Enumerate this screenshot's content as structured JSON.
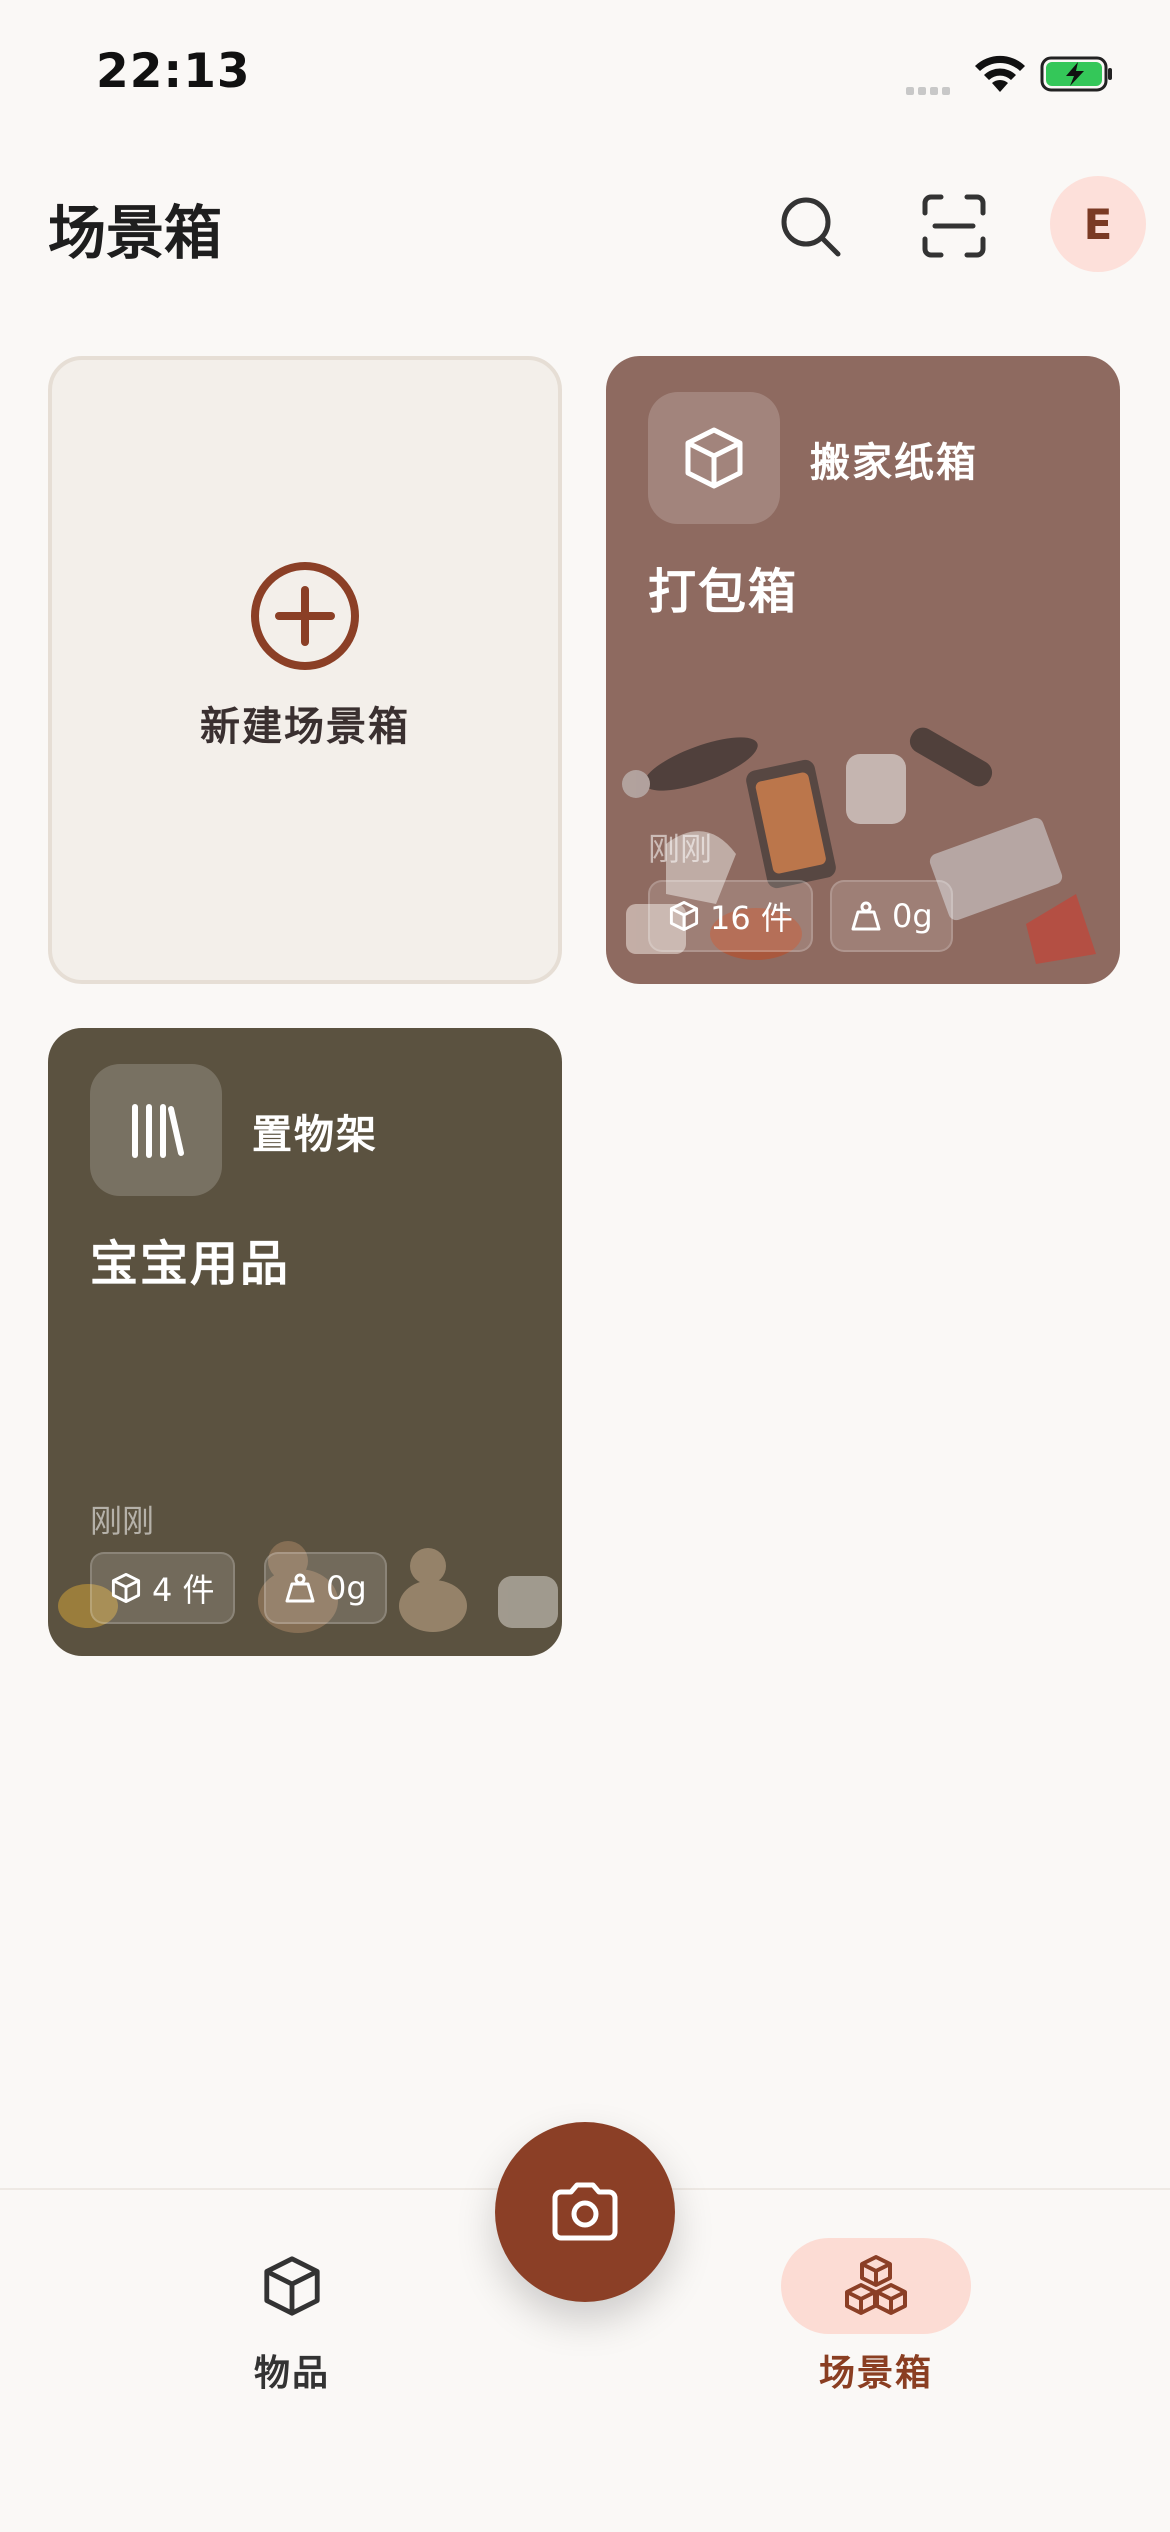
{
  "status_bar": {
    "time": "22:13"
  },
  "header": {
    "title": "场景箱",
    "avatar_initial": "E"
  },
  "new_card": {
    "label": "新建场景箱"
  },
  "cards": [
    {
      "type_label": "搬家纸箱",
      "title": "打包箱",
      "time": "刚刚",
      "count": "16 件",
      "weight": "0g",
      "type_icon": "box-icon",
      "bg": "#8e6a60"
    },
    {
      "type_label": "置物架",
      "title": "宝宝用品",
      "time": "刚刚",
      "count": "4 件",
      "weight": "0g",
      "type_icon": "shelf-icon",
      "bg": "#5b5240"
    }
  ],
  "nav": {
    "items_label": "物品",
    "scenes_label": "场景箱"
  },
  "colors": {
    "accent": "#8b3f26",
    "accent_soft": "#fcdcd4",
    "background": "#faf8f6"
  }
}
